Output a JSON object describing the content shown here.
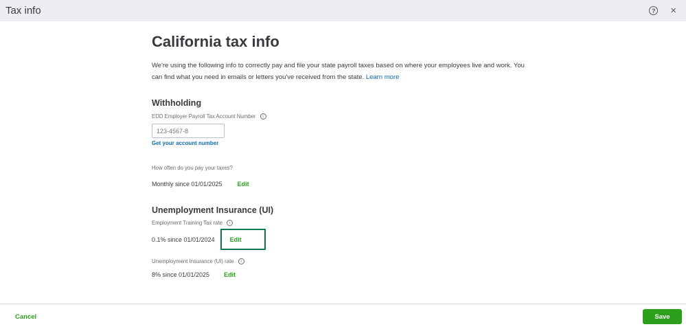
{
  "header": {
    "title": "Tax info",
    "help_icon": "?",
    "close_icon": "×"
  },
  "page": {
    "title": "California tax info",
    "intro": "We're using the following info to correctly pay and file your state payroll taxes based on where your employees live and work. You can find what you need in emails or letters you've received from the state.",
    "learn_more": "Learn more"
  },
  "withholding": {
    "heading": "Withholding",
    "account_label": "EDD Employer Payroll Tax Account Number",
    "account_placeholder": "123-4567-8",
    "account_value": "",
    "get_number": "Get your account number",
    "freq_label": "How often do you pay your taxes?",
    "freq_value": "Monthly since 01/01/2025",
    "edit": "Edit"
  },
  "ui": {
    "heading": "Unemployment Insurance (UI)",
    "ett_label": "Employment Training Tax rate",
    "ett_value": "0.1% since 01/01/2024",
    "ett_edit": "Edit",
    "ui_label": "Unemployment Insurance (UI) rate",
    "ui_value": "8% since 01/01/2025",
    "ui_edit": "Edit"
  },
  "footer": {
    "cancel": "Cancel",
    "save": "Save"
  }
}
